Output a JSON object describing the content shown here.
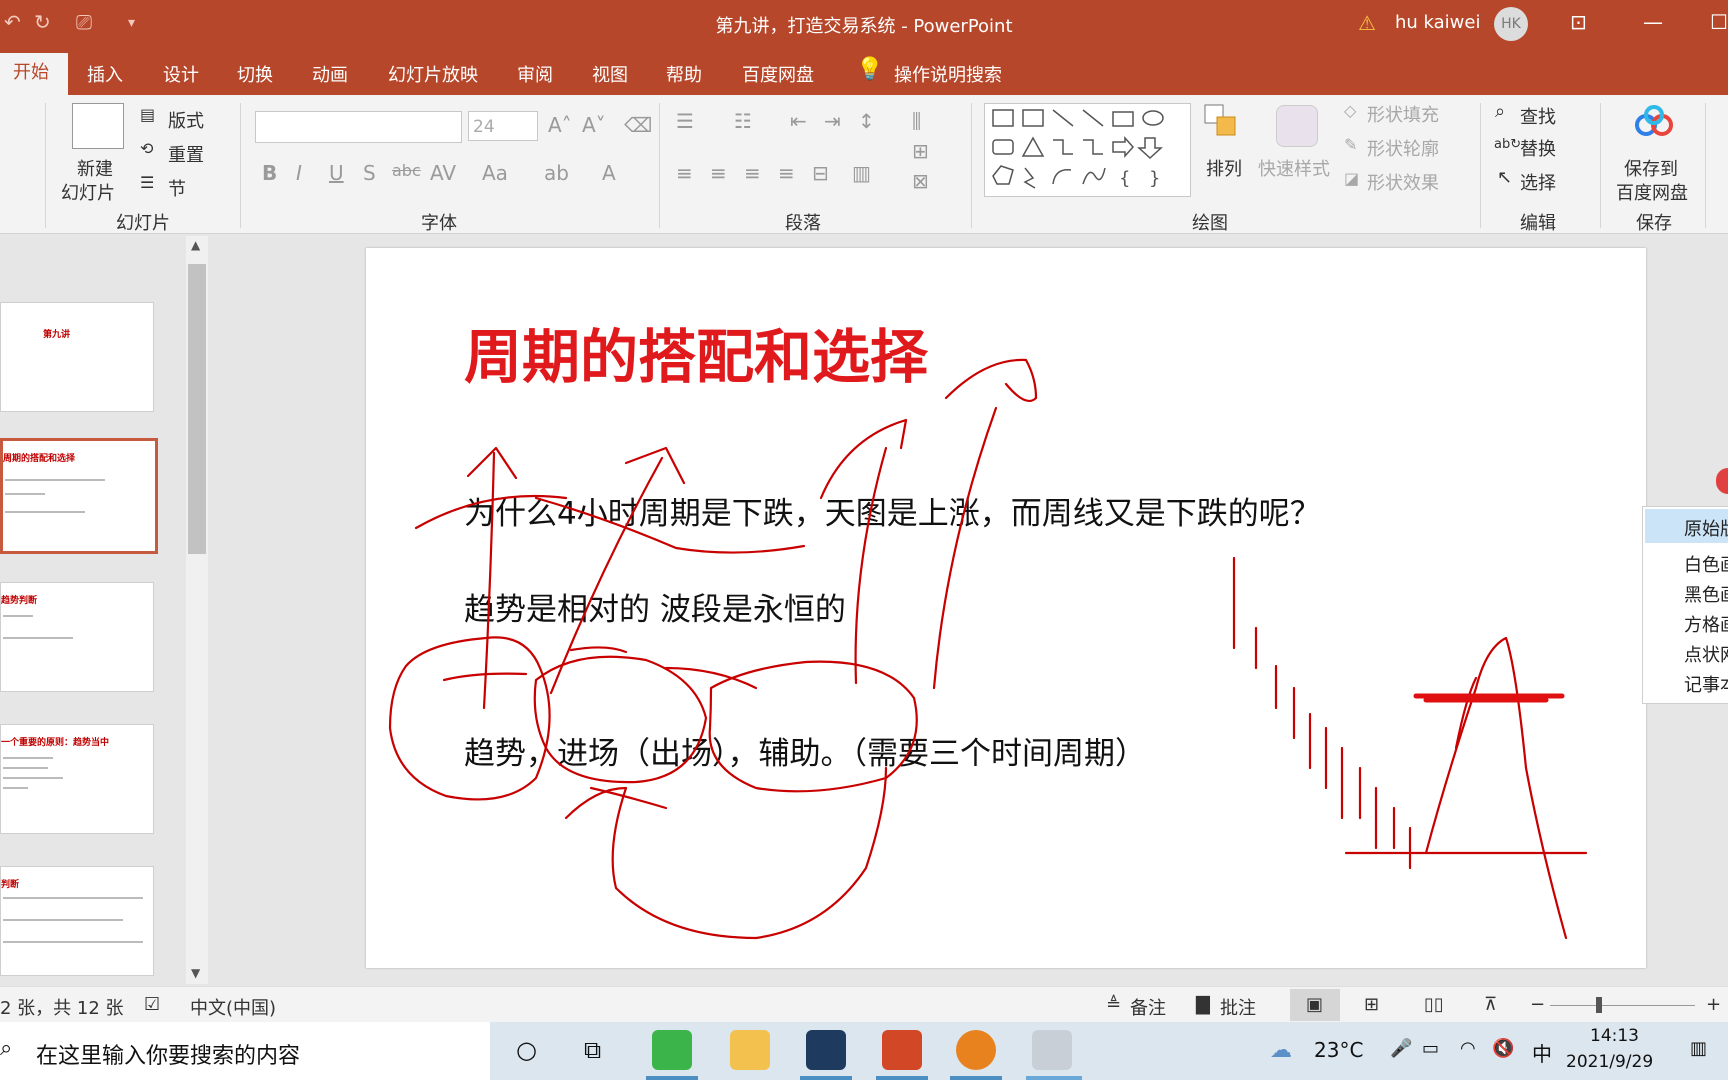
{
  "window": {
    "title": "第九讲，打造交易系统  -  PowerPoint",
    "user_name": "hu kaiwei",
    "user_initials": "HK"
  },
  "tabs": [
    "开始",
    "插入",
    "设计",
    "切换",
    "动画",
    "幻灯片放映",
    "审阅",
    "视图",
    "帮助",
    "百度网盘"
  ],
  "tell_me": "操作说明搜索",
  "ribbon": {
    "slides_group": {
      "new_slide": "新建",
      "new_slide_2": "幻灯片",
      "layout": "版式",
      "reset": "重置",
      "section": "节",
      "label": "幻灯片"
    },
    "font_group": {
      "size": "24",
      "label": "字体"
    },
    "paragraph_group": {
      "label": "段落"
    },
    "drawing_group": {
      "arrange": "排列",
      "quick_styles": "快速样式",
      "shape_fill": "形状填充",
      "shape_outline": "形状轮廓",
      "shape_effects": "形状效果",
      "label": "绘图"
    },
    "editing_group": {
      "find": "查找",
      "replace": "替换",
      "select": "选择",
      "label": "编辑"
    },
    "save_group": {
      "save_to": "保存到",
      "baidu": "百度网盘",
      "label": "保存"
    }
  },
  "thumbnails": [
    {
      "title": "第九讲"
    },
    {
      "title": "周期的搭配和选择"
    },
    {
      "title": "趋势判断"
    },
    {
      "title": "一个重要的原则：趋势当中"
    },
    {
      "title": "判断"
    }
  ],
  "slide": {
    "title": "周期的搭配和选择",
    "line1": "为什么4小时周期是下跌，天图是上涨，而周线又是下跌的呢？",
    "line2": "趋势是相对的 波段是永恒的",
    "line3": "趋势，进场（出场），辅助。（需要三个时间周期）"
  },
  "context_menu": [
    "原始版",
    "白色画",
    "黑色画",
    "方格画",
    "点状网",
    "记事本"
  ],
  "status": {
    "slide_count": "2 张，共 12 张",
    "language": "中文(中国)",
    "notes": "备注",
    "comments": "批注"
  },
  "taskbar": {
    "search_placeholder": "在这里输入你要搜索的内容",
    "temperature": "23°C",
    "ime": "中",
    "time": "14:13",
    "date": "2021/9/29"
  },
  "colors": {
    "accent": "#b7472a",
    "ink": "#c80000",
    "title_red": "#e0191c"
  }
}
